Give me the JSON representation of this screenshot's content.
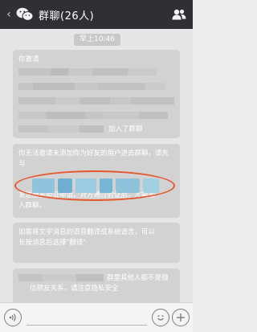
{
  "header": {
    "back_label": "‹",
    "title": "群聊(26人)"
  },
  "chat": {
    "timestamp": "早上10:46",
    "messages": [
      {
        "lines": [
          "你邀请",
          "",
          "",
          "",
          "",
          "加入了群聊"
        ]
      },
      {
        "lines": [
          "你无法邀请未添加你为好友的用户进去群聊，请先与",
          "",
          "发送朋友验证申请。对方通过验证后，才能加",
          "入群聊。"
        ]
      },
      {
        "lines": [
          "如需将文字消息的语音翻译成系统语言，可以",
          "长按消息后选择\"翻译\""
        ]
      },
      {
        "lines": [
          "群里其他人都不是微",
          "信朋友关系，请注意隐私安全"
        ]
      }
    ]
  },
  "input_bar": {
    "placeholder": ""
  },
  "colors": {
    "header_bg": "#2f2f34",
    "chat_bg": "#e6e6e6",
    "bubble_bg": "#d2d2d2",
    "highlight_oval": "#e5562c"
  },
  "icons": {
    "back": "chevron-left-icon",
    "logo": "wechat-logo-icon",
    "contacts": "group-contacts-icon",
    "voice": "voice-icon",
    "emoji": "emoji-icon",
    "plus": "plus-icon"
  }
}
